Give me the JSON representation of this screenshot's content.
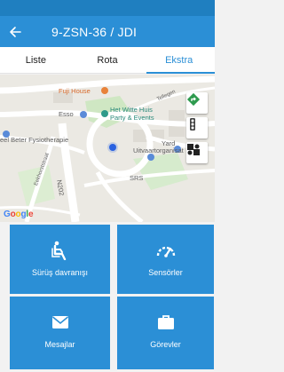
{
  "header": {
    "title": "9-ZSN-36 / JDI"
  },
  "tabs": [
    {
      "label": "Liste"
    },
    {
      "label": "Rota"
    },
    {
      "label": "Ekstra"
    }
  ],
  "map": {
    "labels": {
      "fuji_house": "Fuji House",
      "esso": "Esso",
      "het_witte_huis_line1": "Het Witte Huis",
      "het_witte_huis_line2": "Party & Events",
      "fysiotherapie": "eel Beter Fysiotherapie",
      "yard": "Yard",
      "uitvaartorganisatie": "Uitvaartorganisat",
      "srs": "SRS",
      "road_n202": "N202",
      "street_left": "Eekhorststraat",
      "street_right": "Tellegen"
    },
    "logo": [
      "G",
      "o",
      "o",
      "g",
      "l",
      "e"
    ]
  },
  "tiles": [
    {
      "label": "Sürüş davranışı",
      "icon": "driver-seat-icon"
    },
    {
      "label": "Sensörler",
      "icon": "speedometer-icon"
    },
    {
      "label": "Mesajlar",
      "icon": "envelope-icon"
    },
    {
      "label": "Görevler",
      "icon": "briefcase-icon"
    }
  ],
  "colors": {
    "primary": "#2b8fd6",
    "status_bar": "#1f7fc0",
    "active_tab": "#2b8fd6",
    "location_dot": "#2a62e0",
    "poi_orange": "#e8823a",
    "poi_teal": "#2f9a8a",
    "poi_blue": "#5a8bd8"
  }
}
